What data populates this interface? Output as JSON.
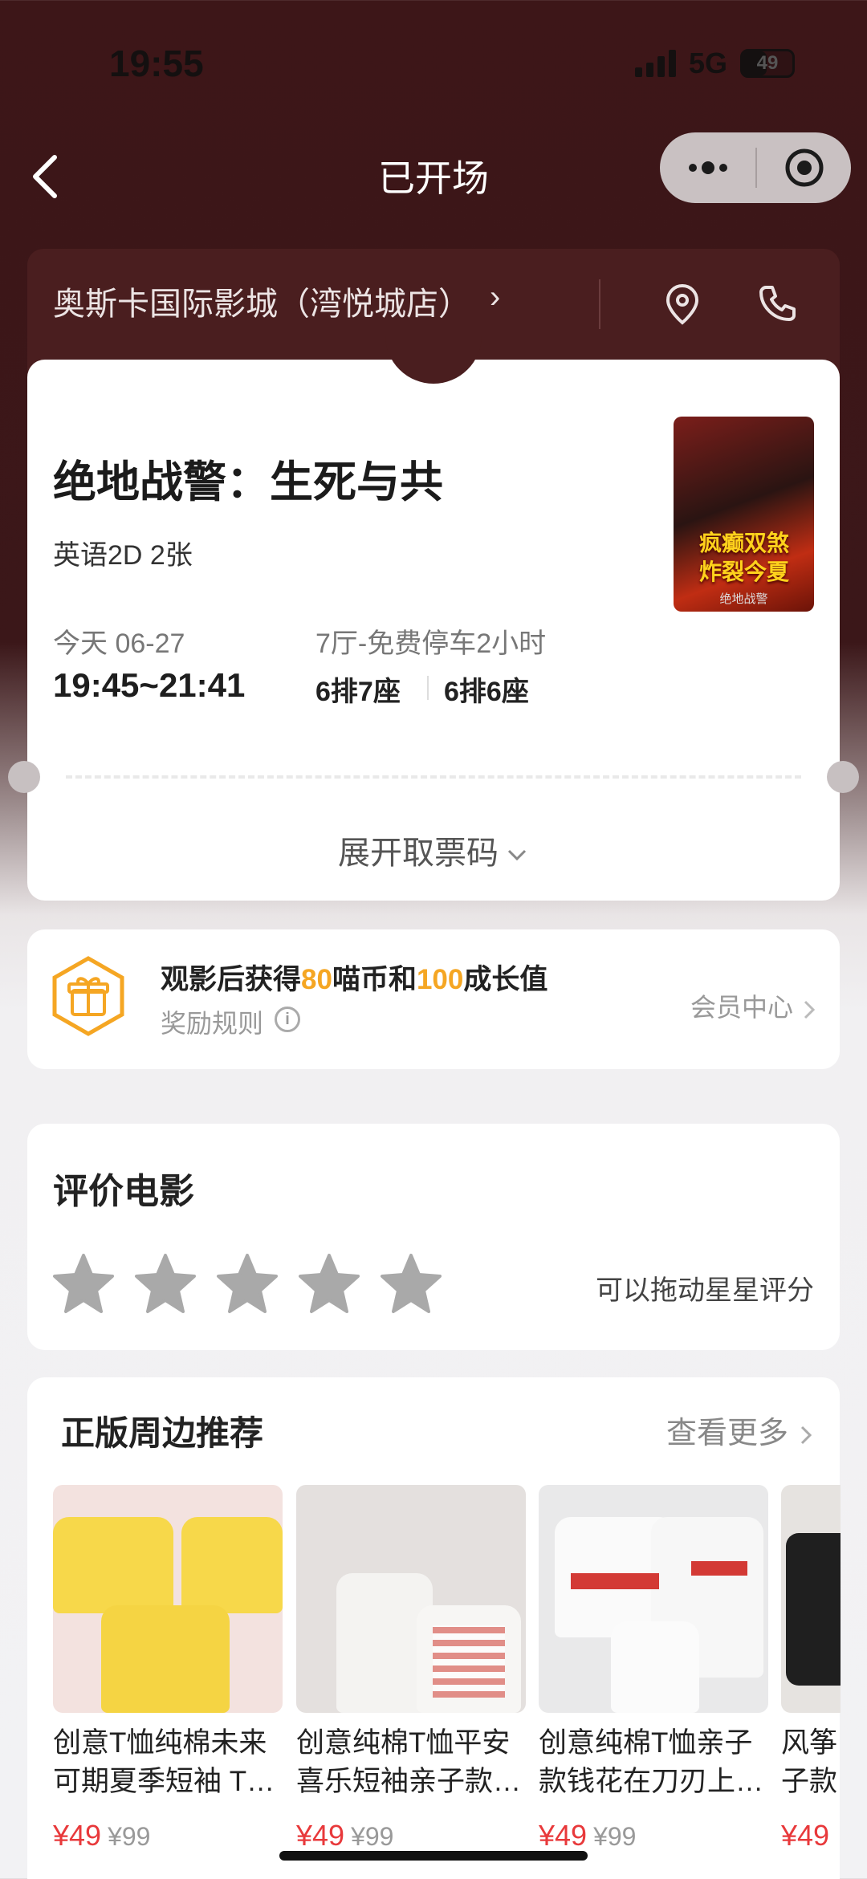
{
  "status_bar": {
    "time": "19:55",
    "network": "5G",
    "battery": "49"
  },
  "nav": {
    "title": "已开场"
  },
  "cinema": {
    "name": "奥斯卡国际影城（湾悦城店）",
    "arrow": "›"
  },
  "ticket": {
    "movie_title": "绝地战警：生死与共",
    "format": "英语2D 2张",
    "date": "今天 06-27",
    "showtime": "19:45~21:41",
    "hall": "7厅-免费停车2小时",
    "seats": [
      "6排7座",
      "6排6座"
    ],
    "expand_label": "展开取票码",
    "poster_text": "疯癫双煞\n炸裂今夏",
    "poster_small": "绝地战警"
  },
  "reward": {
    "text_pre": "观影后获得",
    "coins": "80",
    "text_mid": "喵币和",
    "growth": "100",
    "text_post": "成长值",
    "rules": "奖励规则",
    "member_center": "会员中心"
  },
  "rating": {
    "title": "评价电影",
    "hint": "可以拖动星星评分",
    "stars": 5,
    "selected": 0
  },
  "merch": {
    "title": "正版周边推荐",
    "more": "查看更多",
    "products": [
      {
        "name": "创意T恤纯棉未来可期夏季短袖 T…",
        "price": "¥49",
        "orig": "¥99"
      },
      {
        "name": "创意纯棉T恤平安喜乐短袖亲子款…",
        "price": "¥49",
        "orig": "¥99"
      },
      {
        "name": "创意纯棉T恤亲子款钱花在刀刃上…",
        "price": "¥49",
        "orig": "¥99"
      },
      {
        "name": "风筝子款",
        "price": "¥49",
        "orig": ""
      }
    ]
  },
  "colors": {
    "accent": "#f5a623",
    "price": "#e8393b",
    "header_bg": "#3d1618"
  }
}
